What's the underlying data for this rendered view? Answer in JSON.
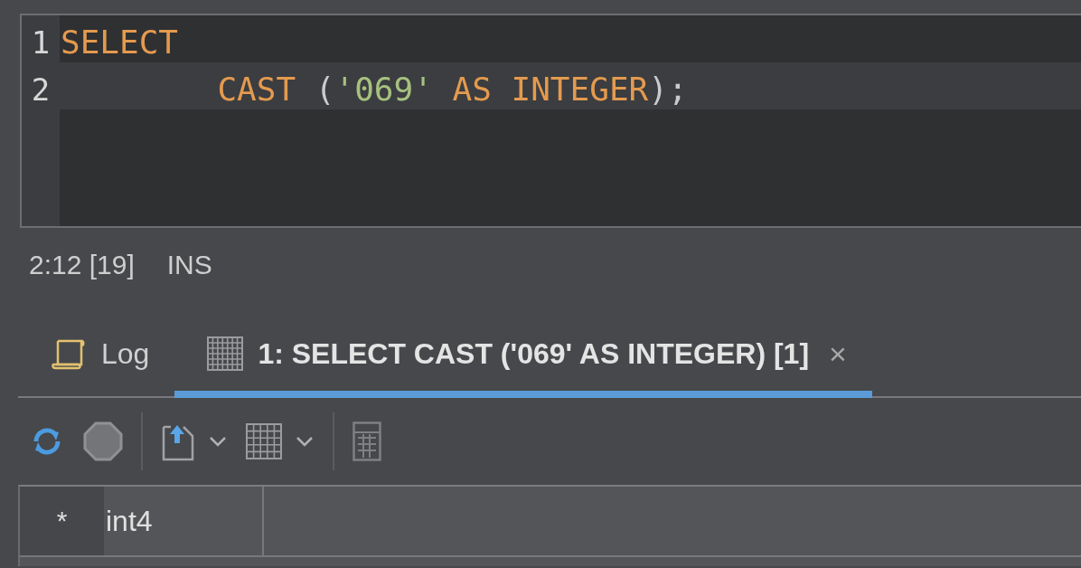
{
  "editor": {
    "lines": [
      {
        "number": "1",
        "current": false,
        "tokens": [
          {
            "kind": "keyword",
            "text": "SELECT"
          }
        ]
      },
      {
        "number": "2",
        "current": true,
        "tokens": [
          {
            "kind": "keyword",
            "text": "        CAST"
          },
          {
            "kind": "plain",
            "text": " ("
          },
          {
            "kind": "string",
            "text": "'069'"
          },
          {
            "kind": "keyword",
            "text": " AS INTEGER"
          },
          {
            "kind": "plain",
            "text": ");"
          }
        ]
      }
    ]
  },
  "status_bar": {
    "position": "2:12 [19]",
    "mode": "INS"
  },
  "tabs": [
    {
      "label": "Log",
      "selected": false
    },
    {
      "label": "1: SELECT CAST ('069' AS INTEGER) [1]",
      "selected": true,
      "close": "×"
    }
  ],
  "result_grid": {
    "row_header": "*",
    "columns": [
      "int4"
    ]
  }
}
